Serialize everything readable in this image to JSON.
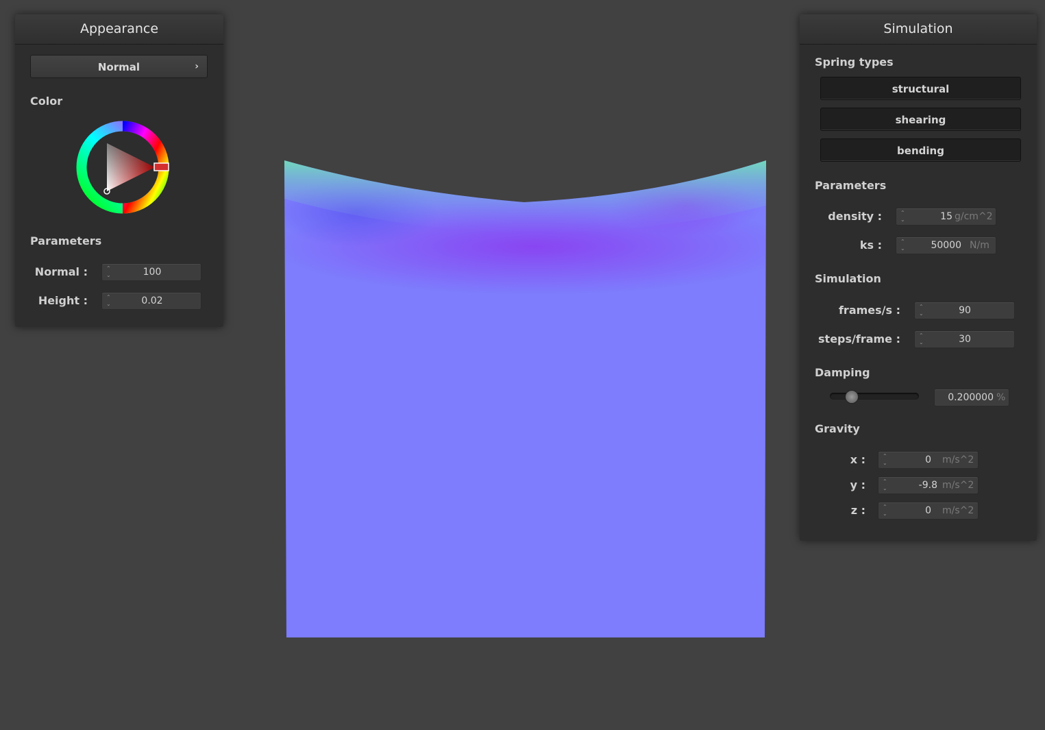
{
  "appearance": {
    "title": "Appearance",
    "shader_select": "Normal",
    "color_label": "Color",
    "parameters_label": "Parameters",
    "normal_label": "Normal :",
    "normal_value": "100",
    "height_label": "Height :",
    "height_value": "0.02",
    "color_hex": "#d32f2f"
  },
  "simulation": {
    "title": "Simulation",
    "spring_types_label": "Spring types",
    "spring_buttons": [
      "structural",
      "shearing",
      "bending"
    ],
    "parameters_label": "Parameters",
    "density_label": "density :",
    "density_value": "15",
    "density_unit": "g/cm^2",
    "ks_label": "ks :",
    "ks_value": "50000",
    "ks_unit": "N/m",
    "simulation_label": "Simulation",
    "fps_label": "frames/s :",
    "fps_value": "90",
    "steps_label": "steps/frame :",
    "steps_value": "30",
    "damping_label": "Damping",
    "damping_value": "0.200000",
    "damping_unit": "%",
    "damping_slider_fraction": 0.2,
    "gravity_label": "Gravity",
    "gx_label": "x :",
    "gx_value": "0",
    "gy_label": "y :",
    "gy_value": "-9.8",
    "gz_label": "z :",
    "gz_value": "0",
    "gravity_unit": "m/s^2"
  },
  "colors": {
    "background": "#414141",
    "panel": "#2d2d2d",
    "cloth_base": "#7b7cfc",
    "cloth_fold_purple": "#8e4ff0",
    "cloth_edge_green": "#6ee6b4"
  }
}
